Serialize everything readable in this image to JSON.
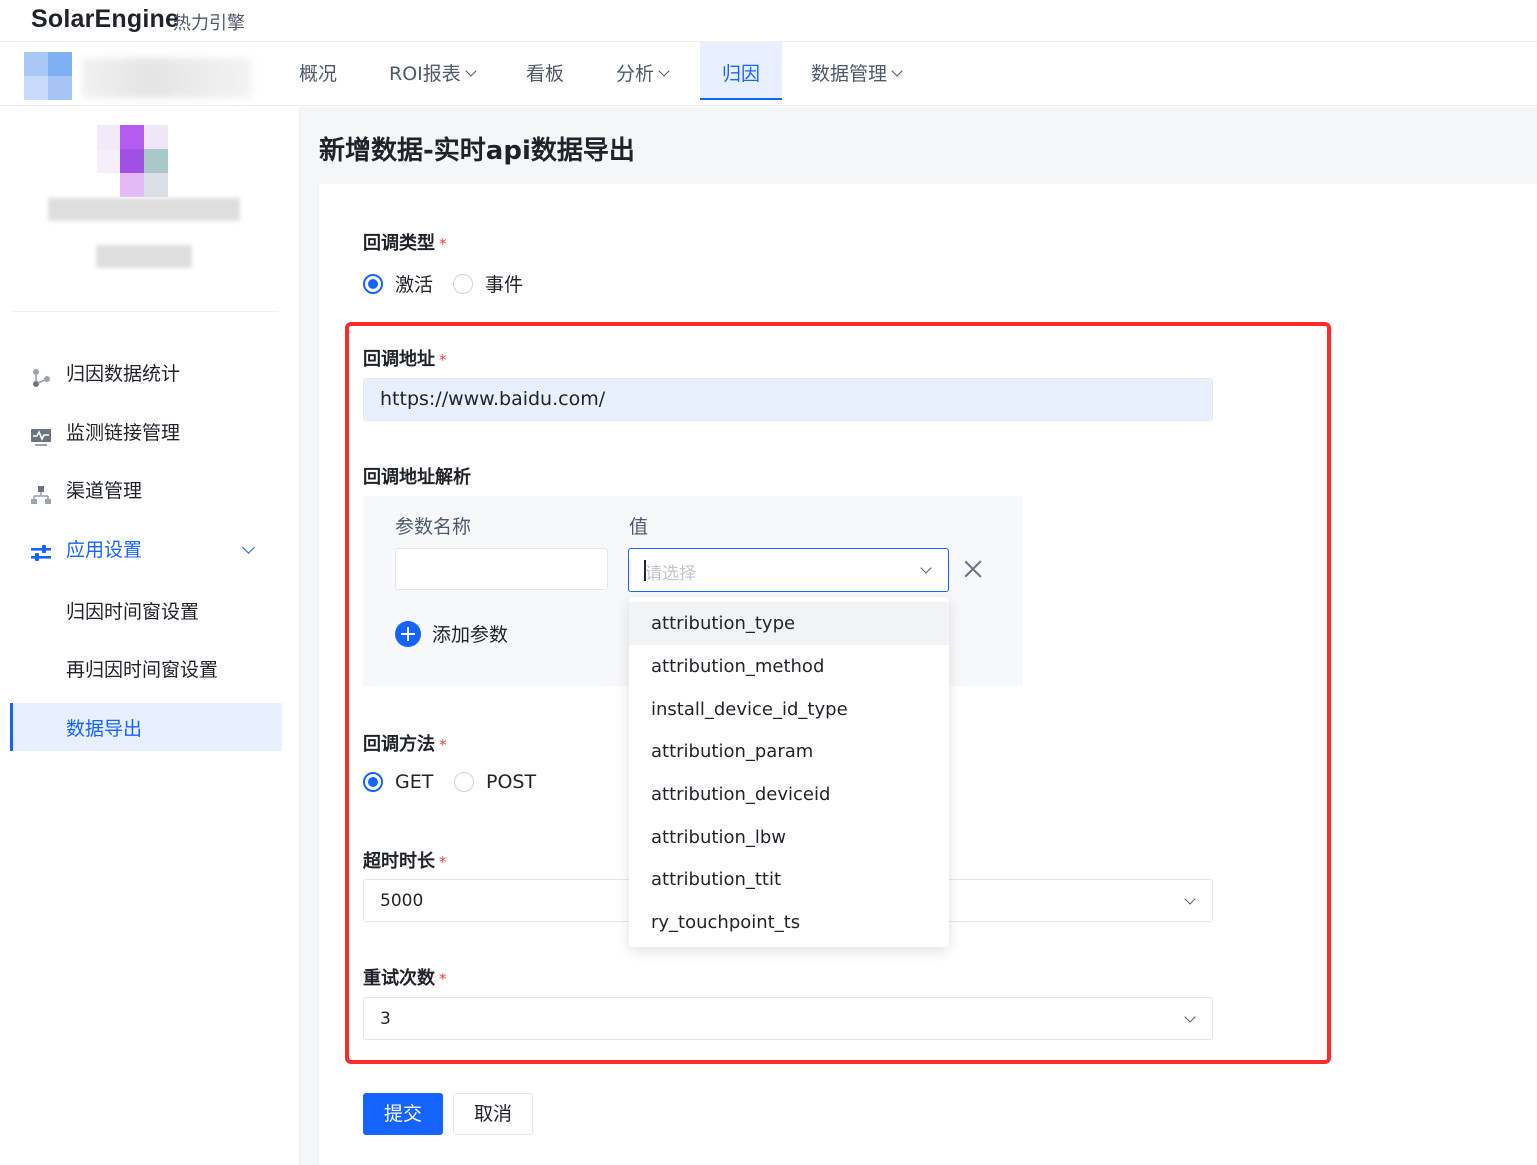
{
  "brand": {
    "name": "SolarEngine",
    "sub": "热力引擎"
  },
  "nav": {
    "items": [
      {
        "label": "概况",
        "dropdown": false
      },
      {
        "label": "ROI报表",
        "dropdown": true
      },
      {
        "label": "看板",
        "dropdown": false
      },
      {
        "label": "分析",
        "dropdown": true
      },
      {
        "label": "归因",
        "dropdown": false,
        "active": true
      },
      {
        "label": "数据管理",
        "dropdown": true
      }
    ]
  },
  "sidebar": {
    "items": [
      {
        "label": "归因数据统计",
        "icon": "attribution-stats-icon"
      },
      {
        "label": "监测链接管理",
        "icon": "monitor-link-icon"
      },
      {
        "label": "渠道管理",
        "icon": "channel-icon"
      },
      {
        "label": "应用设置",
        "icon": "settings-sliders-icon",
        "expanded": true
      }
    ],
    "sub_items": [
      {
        "label": "归因时间窗设置"
      },
      {
        "label": "再归因时间窗设置"
      },
      {
        "label": "数据导出",
        "active": true
      }
    ]
  },
  "page": {
    "title": "新增数据-实时api数据导出"
  },
  "form": {
    "callback_type": {
      "label": "回调类型",
      "options": [
        "激活",
        "事件"
      ],
      "selected": "激活"
    },
    "callback_url": {
      "label": "回调地址",
      "value": "https://www.baidu.com/"
    },
    "url_parse": {
      "label": "回调地址解析",
      "col_name": "参数名称",
      "col_value": "值",
      "value_placeholder": "请选择",
      "add_label": "添加参数"
    },
    "callback_method": {
      "label": "回调方法",
      "options": [
        "GET",
        "POST"
      ],
      "selected": "GET"
    },
    "timeout": {
      "label": "超时时长",
      "value": "5000"
    },
    "retry": {
      "label": "重试次数",
      "value": "3"
    },
    "submit_label": "提交",
    "cancel_label": "取消"
  },
  "dropdown": {
    "options": [
      "attribution_type",
      "attribution_method",
      "install_device_id_type",
      "attribution_param",
      "attribution_deviceid",
      "attribution_lbw",
      "attribution_ttit",
      "ry_touchpoint_ts"
    ],
    "hovered": "attribution_type"
  },
  "colors": {
    "primary": "#1664ff",
    "required": "#f53f3f",
    "highlight_frame": "#ff2a2a"
  }
}
